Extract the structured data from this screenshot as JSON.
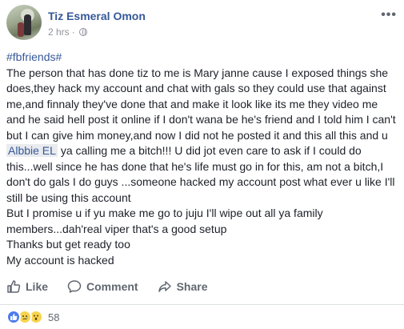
{
  "post": {
    "author": "Tiz Esmeral Omon",
    "time": "2 hrs",
    "separator": "·",
    "more_label": "•••",
    "hashtag": "#fbfriends#",
    "paragraphs": [
      "The person that has done tiz to me is Mary janne cause I exposed things she does,they hack my account and chat with gals so they could use that against me,and finnaly they've done that and make it look like its me they video me and he said hell post it online if I don't wana be he's friend and I told him I can't but I can give him money,and now I did not he posted it and this all this and u ",
      " ya calling me a bitch!!! U did jot even care to ask if I could do this...well since he has done that he's life must go in for this, am not a bitch,I don't do gals I do guys ...someone hacked my account post what ever u like I'll still be using this account"
    ],
    "mention": "Albbie EL",
    "line2": "But I promise u if yu make me go to juju I'll wipe out all ya family members...dah'real viper that's a good setup",
    "line3": "Thanks but get ready too",
    "line4": "My account is hacked"
  },
  "actions": {
    "like": "Like",
    "comment": "Comment",
    "share": "Share"
  },
  "reactions": {
    "icons": [
      "like-reaction-icon",
      "sad-reaction-icon",
      "wow-reaction-icon"
    ],
    "count": "58"
  },
  "colors": {
    "link": "#365899",
    "muted": "#90949c",
    "action": "#606770"
  }
}
